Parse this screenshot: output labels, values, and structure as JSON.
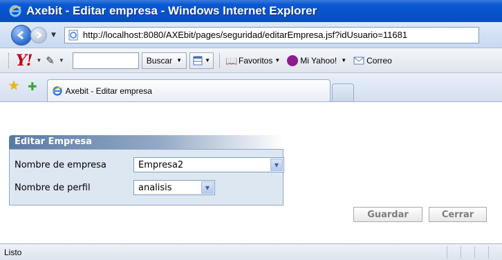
{
  "window": {
    "title": "Axebit - Editar empresa - Windows Internet Explorer"
  },
  "address_bar": {
    "url": "http://localhost:8080/AXEbit/pages/seguridad/editarEmpresa.jsf?idUsuario=11681"
  },
  "yahoo_toolbar": {
    "logo": "Y!",
    "search_placeholder": "",
    "search_button": "Buscar",
    "favoritos": "Favoritos",
    "mi_yahoo": "Mi Yahoo!",
    "correo": "Correo"
  },
  "tabs": [
    {
      "label": "Axebit - Editar empresa"
    }
  ],
  "form": {
    "title": "Editar Empresa",
    "empresa_label": "Nombre de empresa",
    "empresa_value": "Empresa2",
    "perfil_label": "Nombre de perfil",
    "perfil_value": "analisis",
    "guardar_label": "Guardar",
    "cerrar_label": "Cerrar"
  },
  "status_bar": {
    "text": "Listo"
  },
  "colors": {
    "titlebar": "#0752c9",
    "panel_header": "#5979a3",
    "panel_body": "#dde7f2"
  }
}
